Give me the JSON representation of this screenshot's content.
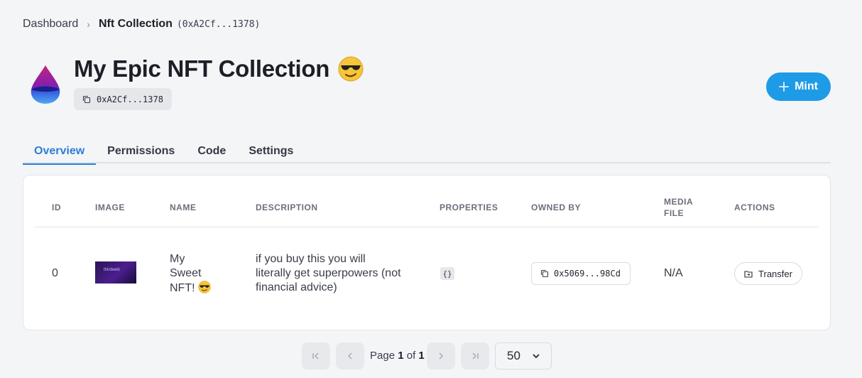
{
  "breadcrumb": {
    "root": "Dashboard",
    "separator": "›",
    "current": "Nft Collection",
    "address": "(0xA2Cf...1378)"
  },
  "header": {
    "title": "My Epic NFT Collection",
    "address": "0xA2Cf...1378",
    "mint_label": "Mint"
  },
  "tabs": [
    {
      "label": "Overview",
      "active": true
    },
    {
      "label": "Permissions",
      "active": false
    },
    {
      "label": "Code",
      "active": false
    },
    {
      "label": "Settings",
      "active": false
    }
  ],
  "table": {
    "columns": [
      "ID",
      "IMAGE",
      "NAME",
      "DESCRIPTION",
      "PROPERTIES",
      "OWNED BY",
      "MEDIA FILE",
      "ACTIONS"
    ],
    "rows": [
      {
        "id": "0",
        "image_label": "thirdweb",
        "name": "My Sweet NFT!",
        "description": "if you buy this you will literally get superpowers (not financial advice)",
        "properties": "{}",
        "owner": "0x5069...98Cd",
        "media_file": "N/A",
        "action": "Transfer"
      }
    ]
  },
  "pagination": {
    "page_prefix": "Page",
    "current_page": "1",
    "of": "of",
    "total_pages": "1",
    "page_size": "50"
  },
  "colors": {
    "accent": "#1e9be6",
    "tab_active": "#2c7fd4",
    "background": "#f4f5f7"
  }
}
